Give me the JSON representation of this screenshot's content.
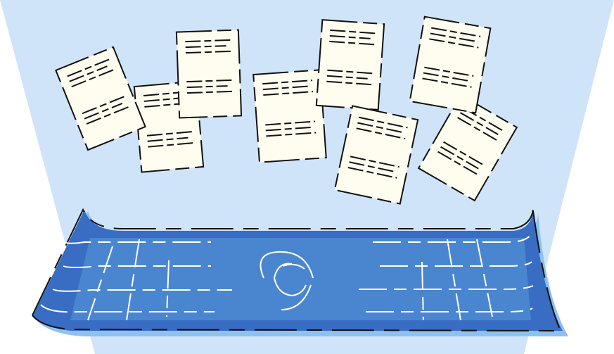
{
  "illustration": {
    "subject": "floating-documents-over-blueprint-sheet",
    "colors": {
      "background": "#ffffff",
      "beam": "#cfe4f8",
      "sheet_outer": "#386dc3",
      "sheet_inner": "#4a86cf",
      "sheet_shadow": "#8fc1f0",
      "paper": "#fffdf0",
      "outline": "#111111",
      "marks": "#ffffff"
    },
    "icons": [
      "document-icon",
      "copyright-icon"
    ],
    "document_count": 8
  }
}
